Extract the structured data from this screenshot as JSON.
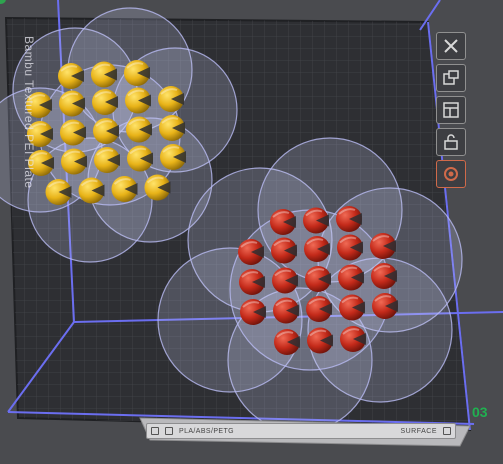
{
  "plate": {
    "name": "Bambu Textured PEI Plate",
    "number": "03",
    "filament_types": "PLA/ABS/PETG",
    "surface_label": "SURFACE"
  },
  "objects": {
    "yellow_group": {
      "color": "#e8b318",
      "rows": [
        3,
        5,
        5,
        5,
        4
      ],
      "count": 22
    },
    "red_group": {
      "color": "#c42a1a",
      "rows": [
        3,
        5,
        5,
        5,
        3
      ],
      "count": 21
    }
  },
  "toolbar": {
    "buttons": [
      {
        "id": "close",
        "icon": "close-icon"
      },
      {
        "id": "arrange",
        "icon": "auto-arrange-icon"
      },
      {
        "id": "layout",
        "icon": "layout-icon"
      },
      {
        "id": "lock",
        "icon": "lock-icon"
      },
      {
        "id": "settings",
        "icon": "settings-icon"
      }
    ]
  },
  "colors": {
    "background": "#4a4b4f",
    "plate": "#2e2f33",
    "grid": "#3a3b40",
    "volume_lines": "#6b6ef0",
    "support_zone": "#c9ccf2",
    "accent": "#d06a4a",
    "plate_number": "#20b050"
  }
}
